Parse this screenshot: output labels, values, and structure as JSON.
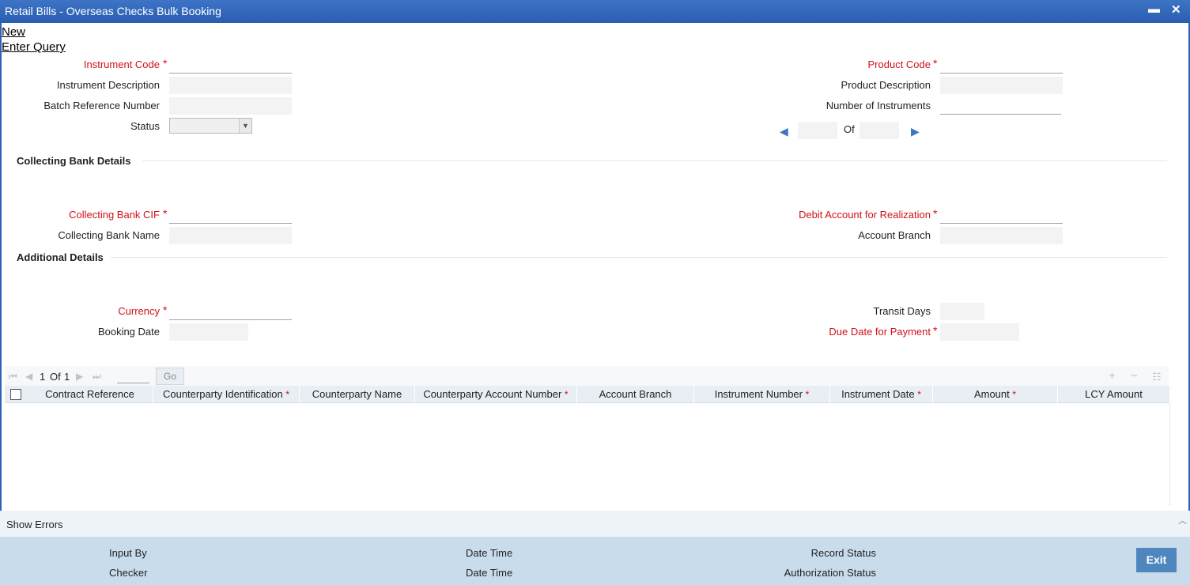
{
  "window": {
    "title": "Retail Bills - Overseas Checks Bulk Booking",
    "minimize": "▬",
    "close": "✕"
  },
  "menu": {
    "new": "New",
    "enter_query": "Enter Query"
  },
  "header": {
    "instrument_code": "Instrument Code",
    "instrument_description": "Instrument Description",
    "batch_reference_number": "Batch Reference Number",
    "status": "Status",
    "product_code": "Product Code",
    "product_description": "Product Description",
    "number_of_instruments": "Number of Instruments",
    "of": "Of"
  },
  "collecting_bank": {
    "title": "Collecting Bank Details",
    "cif": "Collecting Bank CIF",
    "name": "Collecting Bank Name",
    "debit_account": "Debit Account for Realization",
    "account_branch": "Account Branch"
  },
  "additional": {
    "title": "Additional Details",
    "currency": "Currency",
    "booking_date": "Booking Date",
    "transit_days": "Transit Days",
    "due_date": "Due Date for Payment"
  },
  "grid": {
    "page_current": "1",
    "of_label": "Of",
    "page_total": "1",
    "go": "Go",
    "required_mark": "*",
    "columns": [
      {
        "label": "Contract Reference",
        "required": false
      },
      {
        "label": "Counterparty Identification",
        "required": true
      },
      {
        "label": "Counterparty Name",
        "required": false
      },
      {
        "label": "Counterparty Account Number",
        "required": true
      },
      {
        "label": "Account Branch",
        "required": false
      },
      {
        "label": "Instrument Number",
        "required": true
      },
      {
        "label": "Instrument Date",
        "required": true
      },
      {
        "label": "Amount",
        "required": true
      },
      {
        "label": "LCY Amount",
        "required": false
      }
    ]
  },
  "show_errors": "Show Errors",
  "footer": {
    "input_by": "Input By",
    "checker": "Checker",
    "date_time_1": "Date Time",
    "date_time_2": "Date Time",
    "record_status": "Record Status",
    "authorization_status": "Authorization Status",
    "exit": "Exit"
  },
  "colors": {
    "title_bar": "#2f62b5",
    "required": "#d0121b",
    "footer": "#c9dcec",
    "exit_button": "#4e86bd"
  }
}
